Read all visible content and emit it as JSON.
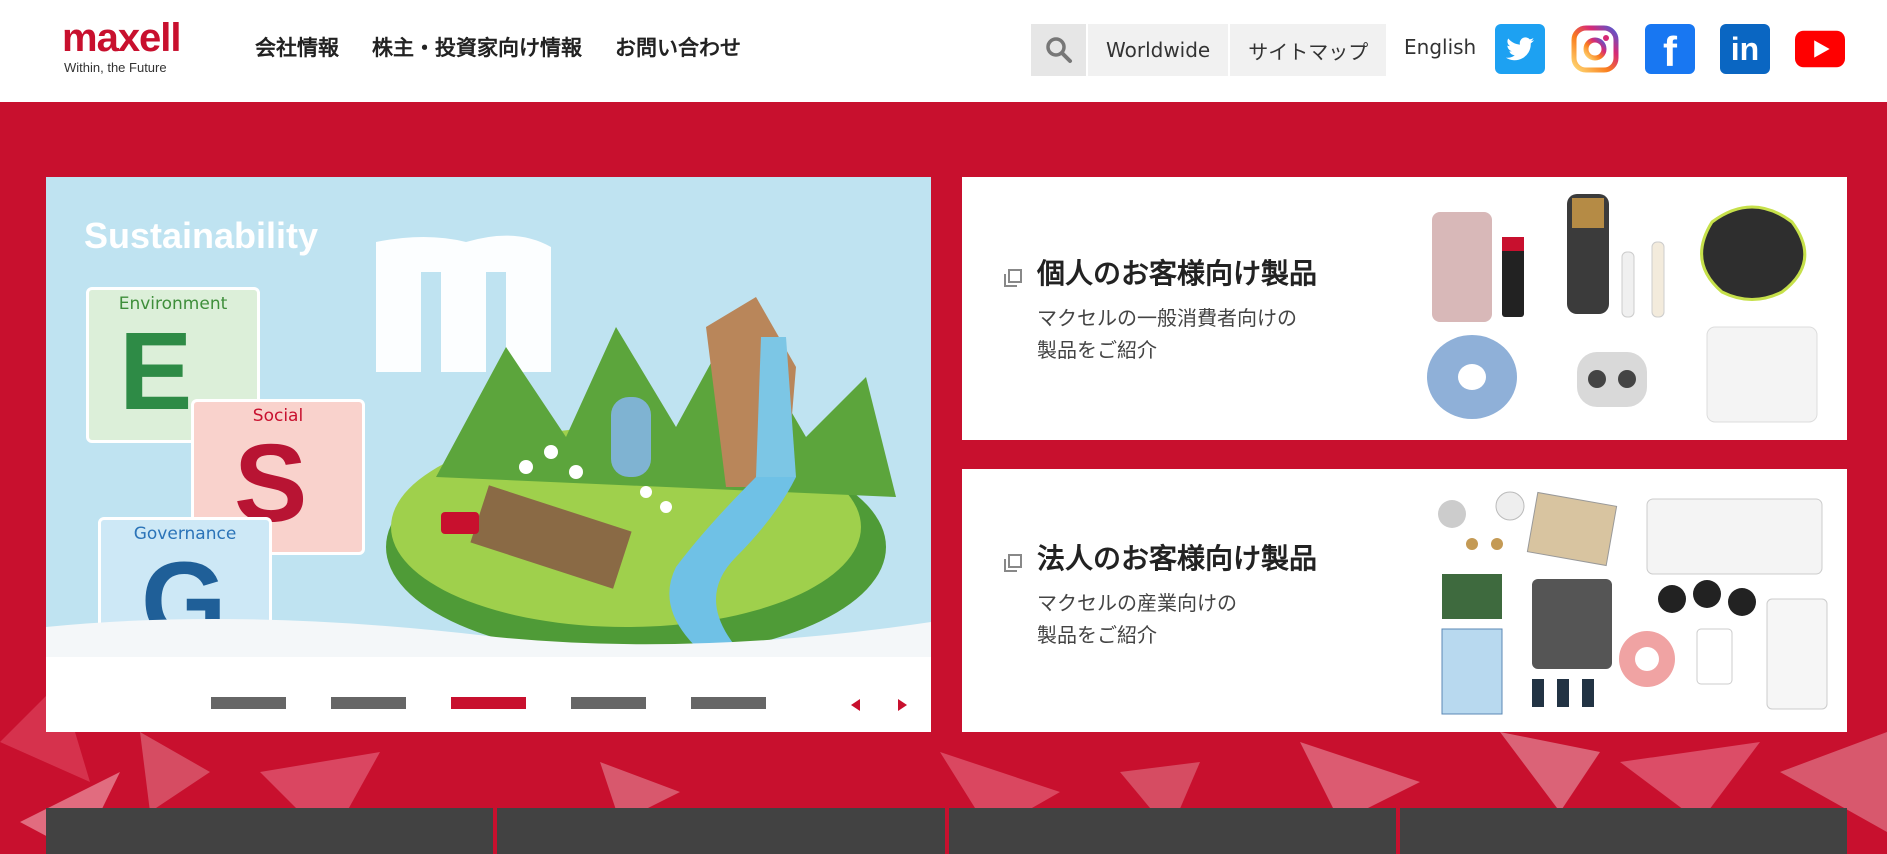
{
  "header": {
    "logo": {
      "word": "maxell",
      "tagline": "Within, the Future"
    },
    "nav": [
      "会社情報",
      "株主・投資家向け情報",
      "お問い合わせ"
    ],
    "utility": {
      "search_icon": "search-icon",
      "buttons": [
        "Worldwide",
        "サイトマップ"
      ]
    },
    "language": "English",
    "social": [
      {
        "name": "twitter-icon",
        "color": "#1da1f2"
      },
      {
        "name": "instagram-icon",
        "color": "#e1306c"
      },
      {
        "name": "facebook-icon",
        "color": "#1877f2"
      },
      {
        "name": "linkedin-icon",
        "color": "#0a66c2"
      },
      {
        "name": "youtube-icon",
        "color": "#ff0000"
      }
    ]
  },
  "colors": {
    "brand_red": "#c8102e",
    "dark_tab": "#424242"
  },
  "slider": {
    "title": "Sustainability",
    "panels": [
      {
        "label": "Environment",
        "letter": "E"
      },
      {
        "label": "Social",
        "letter": "S"
      },
      {
        "label": "Governance",
        "letter": "G"
      }
    ],
    "slide_count": 5,
    "active_index": 2
  },
  "cards": [
    {
      "title": "個人のお客様向け製品",
      "desc": "マクセルの一般消費者向けの\n製品をご紹介"
    },
    {
      "title": "法人のお客様向け製品",
      "desc": "マクセルの産業向けの\n製品をご紹介"
    }
  ]
}
